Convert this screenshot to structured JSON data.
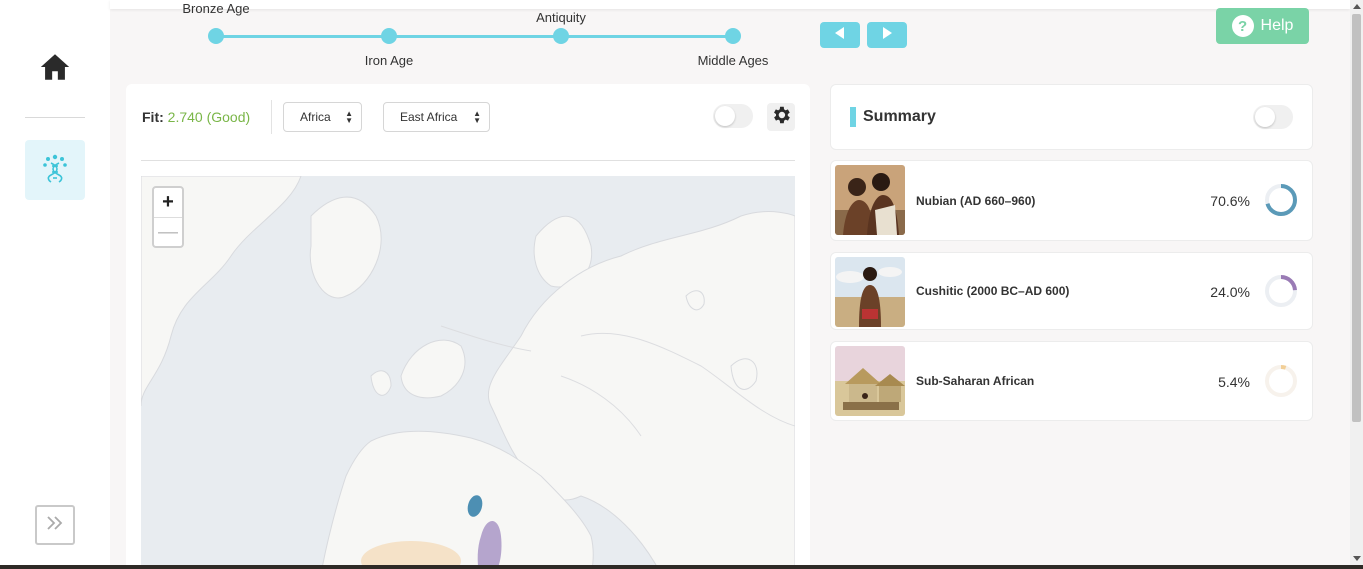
{
  "sidebar": {
    "home_icon": "home-icon",
    "dna_icon": "dna-tree-icon",
    "expand_icon": "double-chevron-right-icon"
  },
  "timeline": {
    "eras": [
      {
        "label": "Bronze Age",
        "position": "above"
      },
      {
        "label": "Iron Age",
        "position": "below"
      },
      {
        "label": "Antiquity",
        "position": "above"
      },
      {
        "label": "Middle Ages",
        "position": "below"
      }
    ],
    "accent": "#6fd4e4"
  },
  "nav": {
    "prev_icon": "triangle-left-icon",
    "next_icon": "triangle-right-icon"
  },
  "help": {
    "label": "Help",
    "icon": "question-circle-icon",
    "color": "#7ad3a7"
  },
  "map_panel": {
    "fit_label": "Fit:",
    "fit_value": "2.740 (Good)",
    "fit_color": "#7ab648",
    "region_select": "Africa",
    "subregion_select": "East Africa",
    "settings_icon": "gear-icon",
    "zoom_in": "+",
    "zoom_out": "—"
  },
  "summary": {
    "title": "Summary",
    "populations": [
      {
        "name": "Nubian (AD 660–960)",
        "percent": "70.6%",
        "fraction": 0.706,
        "color": "#5b9ab8"
      },
      {
        "name": "Cushitic (2000 BC–AD 600)",
        "percent": "24.0%",
        "fraction": 0.24,
        "color": "#9a7bb5"
      },
      {
        "name": "Sub-Saharan African",
        "percent": "5.4%",
        "fraction": 0.054,
        "color": "#f2cf97"
      }
    ]
  }
}
